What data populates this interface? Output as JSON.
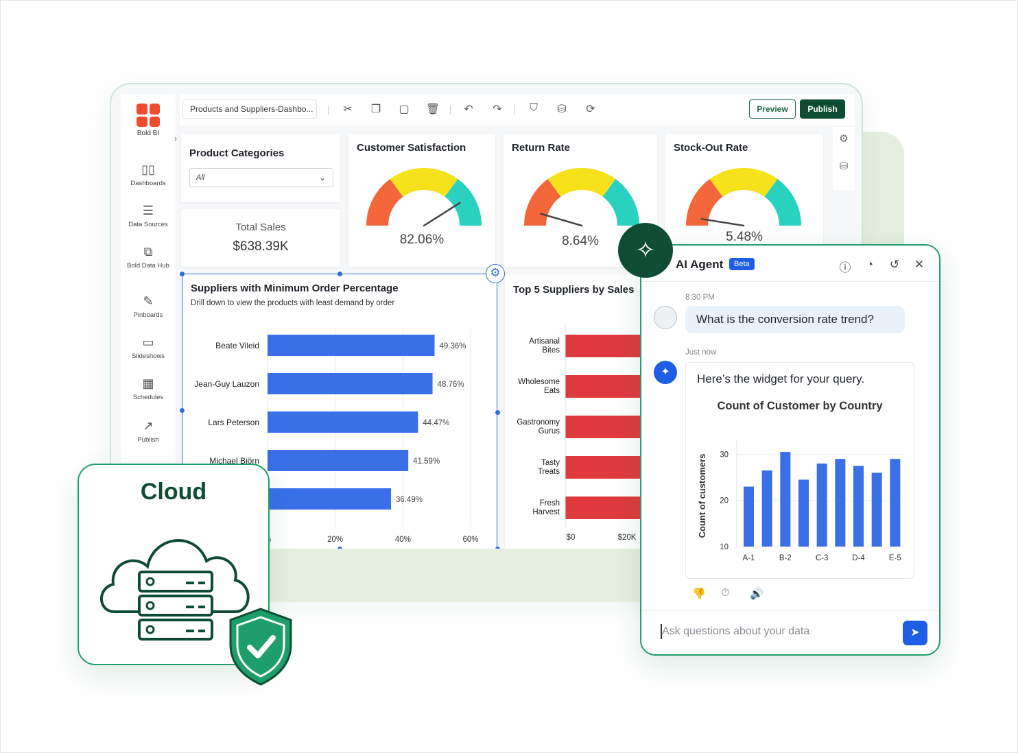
{
  "app": {
    "brand": "Bold BI",
    "tab_title": "Products and Suppliers-Dashbo...",
    "preview_label": "Preview",
    "publish_label": "Publish"
  },
  "sidebar": {
    "items": [
      {
        "label": "Dashboards",
        "icon": "bar-chart-icon"
      },
      {
        "label": "Data Sources",
        "icon": "database-icon"
      },
      {
        "label": "Bold Data Hub",
        "icon": "data-hub-icon"
      },
      {
        "label": "Pinboards",
        "icon": "pin-icon"
      },
      {
        "label": "Slideshows",
        "icon": "tv-icon"
      },
      {
        "label": "Schedules",
        "icon": "calendar-icon"
      },
      {
        "label": "Publish",
        "icon": "share-icon"
      }
    ]
  },
  "widgets": {
    "product_categories": {
      "title": "Product Categories",
      "filter_value": "All"
    },
    "total_sales": {
      "label": "Total Sales",
      "value": "$638.39K"
    },
    "customer_satisfaction": {
      "title": "Customer Satisfaction",
      "value": "82.06%",
      "needle_fraction": 0.82
    },
    "return_rate": {
      "title": "Return Rate",
      "value": "8.64%",
      "needle_fraction": 0.09
    },
    "stock_out_rate": {
      "title": "Stock-Out Rate",
      "value": "5.48%",
      "needle_fraction": 0.05
    },
    "suppliers_min_order": {
      "title": "Suppliers with Minimum Order Percentage",
      "subtitle": "Drill down to view the products with least demand by order"
    },
    "top5_suppliers": {
      "title": "Top 5 Suppliers by Sales"
    }
  },
  "ai_agent": {
    "title": "AI Agent",
    "badge": "Beta",
    "user_time": "8:30 PM",
    "user_message": "What is the conversion rate trend?",
    "bot_time": "Just now",
    "bot_message": "Here’s the widget for your query.",
    "chart_title": "Count of Customer by Country",
    "input_placeholder": "Ask questions about your data"
  },
  "cloud_card": {
    "title": "Cloud"
  },
  "chart_data": [
    {
      "type": "bar",
      "orientation": "horizontal",
      "title": "Suppliers with Minimum Order Percentage",
      "categories": [
        "Beate Vileid",
        "Jean-Guy Lauzon",
        "Lars Peterson",
        "Michael Björn",
        ""
      ],
      "values": [
        49.36,
        48.76,
        44.47,
        41.59,
        36.49
      ],
      "value_labels": [
        "49.36%",
        "48.76%",
        "44.47%",
        "41.59%",
        "36.49%"
      ],
      "xlim": [
        0,
        60
      ],
      "x_ticks": [
        "%",
        "20%",
        "40%",
        "60%"
      ],
      "color": "#3a6fe8",
      "grid": true
    },
    {
      "type": "bar",
      "orientation": "horizontal",
      "title": "Top 5 Suppliers by Sales",
      "categories": [
        "Artisanal Bites",
        "Wholesome Eats",
        "Gastronomy Gurus",
        "Tasty Treats",
        "Fresh Harvest"
      ],
      "x_ticks": [
        "$0",
        "$20K"
      ],
      "color": "#e03a3e"
    },
    {
      "type": "bar",
      "title": "Count of Customer by Country",
      "ylabel": "Count of customers",
      "categories": [
        "A-1",
        "",
        "B-2",
        "",
        "C-3",
        "",
        "D-4",
        "",
        "E-5",
        ""
      ],
      "values": [
        23,
        26.5,
        30.5,
        24.5,
        28,
        29,
        27.5,
        26,
        29
      ],
      "x_labels": [
        "A-1",
        "B-2",
        "C-3",
        "D-4",
        "E-5"
      ],
      "y_ticks": [
        10,
        20,
        30
      ],
      "ylim": [
        10,
        32
      ],
      "color": "#3a6fe8"
    }
  ]
}
